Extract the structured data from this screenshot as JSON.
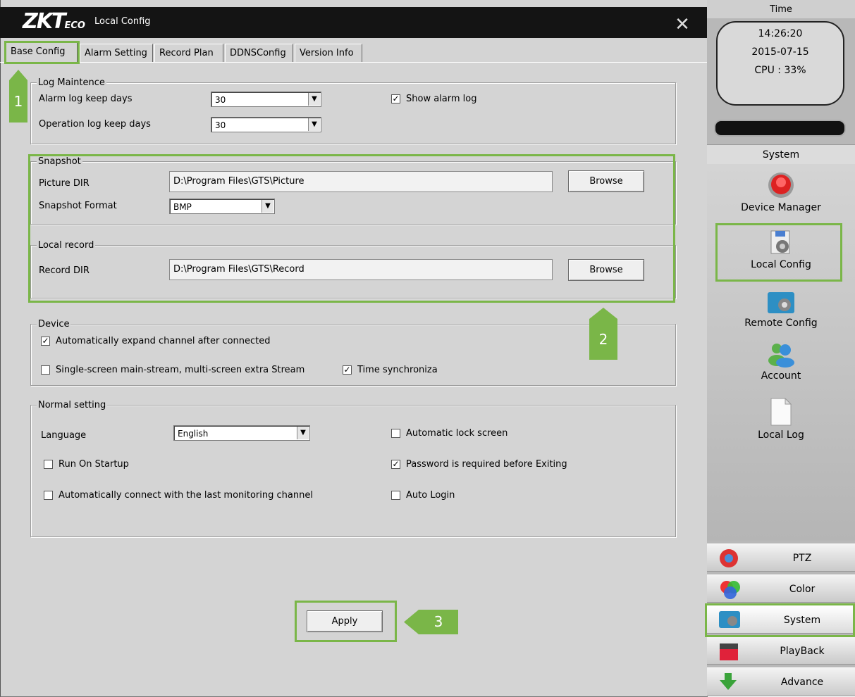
{
  "window": {
    "logo_main": "ZKT",
    "logo_eco": "ECO",
    "title": "Local Config",
    "close_glyph": "✕"
  },
  "tabs": [
    {
      "label": "Base Config",
      "active": true
    },
    {
      "label": "Alarm Setting",
      "active": false
    },
    {
      "label": "Record Plan",
      "active": false
    },
    {
      "label": "DDNSConfig",
      "active": false
    },
    {
      "label": "Version Info",
      "active": false
    }
  ],
  "log_maintence": {
    "legend": "Log Maintence",
    "alarm_label": "Alarm log keep days",
    "alarm_value": "30",
    "operation_label": "Operation log keep days",
    "operation_value": "30",
    "show_alarm_label": "Show alarm log",
    "show_alarm_checked": true
  },
  "snapshot": {
    "legend": "Snapshot",
    "picture_dir_label": "Picture DIR",
    "picture_dir_value": "D:\\Program Files\\GTS\\Picture",
    "browse_label": "Browse",
    "format_label": "Snapshot Format",
    "format_value": "BMP"
  },
  "local_record": {
    "legend": "Local record",
    "record_dir_label": "Record DIR",
    "record_dir_value": "D:\\Program Files\\GTS\\Record",
    "browse_label": "Browse"
  },
  "device": {
    "legend": "Device",
    "auto_expand_label": "Automatically expand channel after connected",
    "auto_expand_checked": true,
    "single_screen_label": "Single-screen main-stream, multi-screen extra Stream",
    "single_screen_checked": false,
    "time_sync_label": "Time synchroniza",
    "time_sync_checked": true
  },
  "normal_setting": {
    "legend": "Normal setting",
    "language_label": "Language",
    "language_value": "English",
    "auto_lock_label": "Automatic lock screen",
    "auto_lock_checked": false,
    "run_startup_label": "Run On Startup",
    "run_startup_checked": false,
    "password_exit_label": "Password is required before Exiting",
    "password_exit_checked": true,
    "auto_connect_label": "Automatically connect with the last monitoring channel",
    "auto_connect_checked": false,
    "auto_login_label": "Auto Login",
    "auto_login_checked": false
  },
  "apply_label": "Apply",
  "callouts": [
    "1",
    "2",
    "3"
  ],
  "highlight_color": "#7ab648",
  "right_panel": {
    "time_header": "Time",
    "clock_time": "14:26:20",
    "clock_date": "2015-07-15",
    "cpu": "CPU : 33%",
    "section_title": "System",
    "menu": [
      {
        "label": "Device Manager",
        "icon": "device-manager-icon"
      },
      {
        "label": "Local Config",
        "icon": "local-config-icon"
      },
      {
        "label": "Remote Config",
        "icon": "remote-config-icon"
      },
      {
        "label": "Account",
        "icon": "account-icon"
      },
      {
        "label": "Local Log",
        "icon": "local-log-icon"
      }
    ],
    "bottom_nav": [
      {
        "label": "PTZ",
        "icon": "ptz-icon"
      },
      {
        "label": "Color",
        "icon": "color-icon"
      },
      {
        "label": "System",
        "icon": "system-icon"
      },
      {
        "label": "PlayBack",
        "icon": "playback-icon"
      },
      {
        "label": "Advance",
        "icon": "advance-icon"
      }
    ]
  }
}
